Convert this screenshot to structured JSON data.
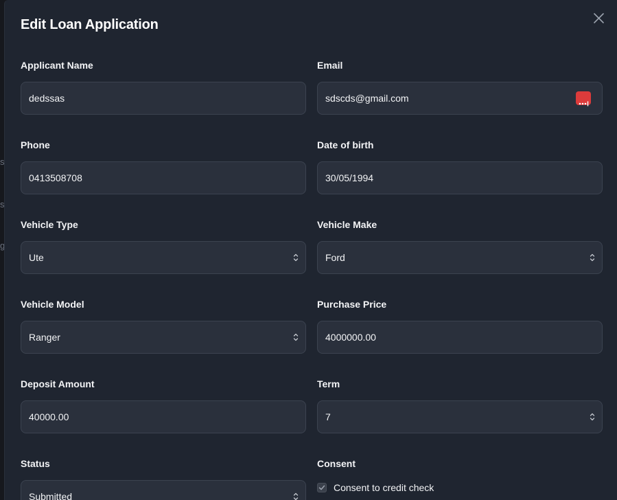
{
  "modal": {
    "title": "Edit Loan Application"
  },
  "form": {
    "applicant_name": {
      "label": "Applicant Name",
      "value": "dedssas"
    },
    "email": {
      "label": "Email",
      "value": "sdscds@gmail.com"
    },
    "phone": {
      "label": "Phone",
      "value": "0413508708"
    },
    "dob": {
      "label": "Date of birth",
      "value": "30/05/1994"
    },
    "vehicle_type": {
      "label": "Vehicle Type",
      "value": "Ute"
    },
    "vehicle_make": {
      "label": "Vehicle Make",
      "value": "Ford"
    },
    "vehicle_model": {
      "label": "Vehicle Model",
      "value": "Ranger"
    },
    "purchase_price": {
      "label": "Purchase Price",
      "value": "4000000.00"
    },
    "deposit_amount": {
      "label": "Deposit Amount",
      "value": "40000.00"
    },
    "term": {
      "label": "Term",
      "value": "7"
    },
    "status": {
      "label": "Status",
      "value": "Submitted"
    },
    "consent": {
      "label": "Consent",
      "checkbox_label": "Consent to credit check",
      "checked": true
    }
  },
  "icons": {
    "close": "close-icon",
    "select": "chevron-updown-icon",
    "password_manager": "password-manager-icon",
    "check": "check-icon"
  },
  "colors": {
    "modal_bg": "#1f2530",
    "input_bg": "#2a303c",
    "input_border": "#3c4350",
    "text": "#f3f4f6",
    "password_manager": "#dc3b3b"
  }
}
